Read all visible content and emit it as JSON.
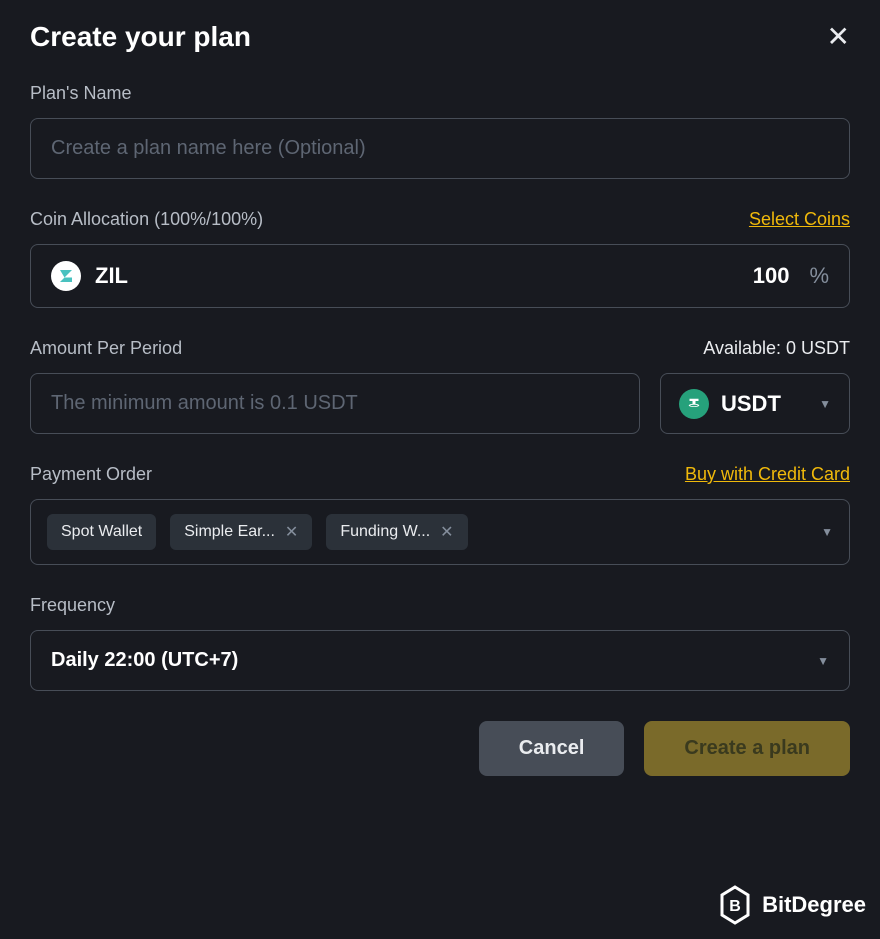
{
  "header": {
    "title": "Create your plan"
  },
  "plan_name": {
    "label": "Plan's Name",
    "placeholder": "Create a plan name here (Optional)"
  },
  "allocation": {
    "label": "Coin Allocation (100%/100%)",
    "select_link": "Select Coins",
    "coin": {
      "symbol": "ZIL",
      "pct": "100",
      "pct_sign": "%"
    }
  },
  "amount": {
    "label": "Amount Per Period",
    "available": "Available: 0 USDT",
    "placeholder": "The minimum amount is 0.1 USDT",
    "currency": "USDT"
  },
  "payment": {
    "label": "Payment Order",
    "link": "Buy with Credit Card",
    "chips": [
      {
        "label": "Spot Wallet",
        "removable": false
      },
      {
        "label": "Simple Ear...",
        "removable": true
      },
      {
        "label": "Funding W...",
        "removable": true
      }
    ]
  },
  "frequency": {
    "label": "Frequency",
    "value": "Daily 22:00 (UTC+7)"
  },
  "buttons": {
    "cancel": "Cancel",
    "create": "Create a plan"
  },
  "watermark": {
    "text": "BitDegree"
  }
}
